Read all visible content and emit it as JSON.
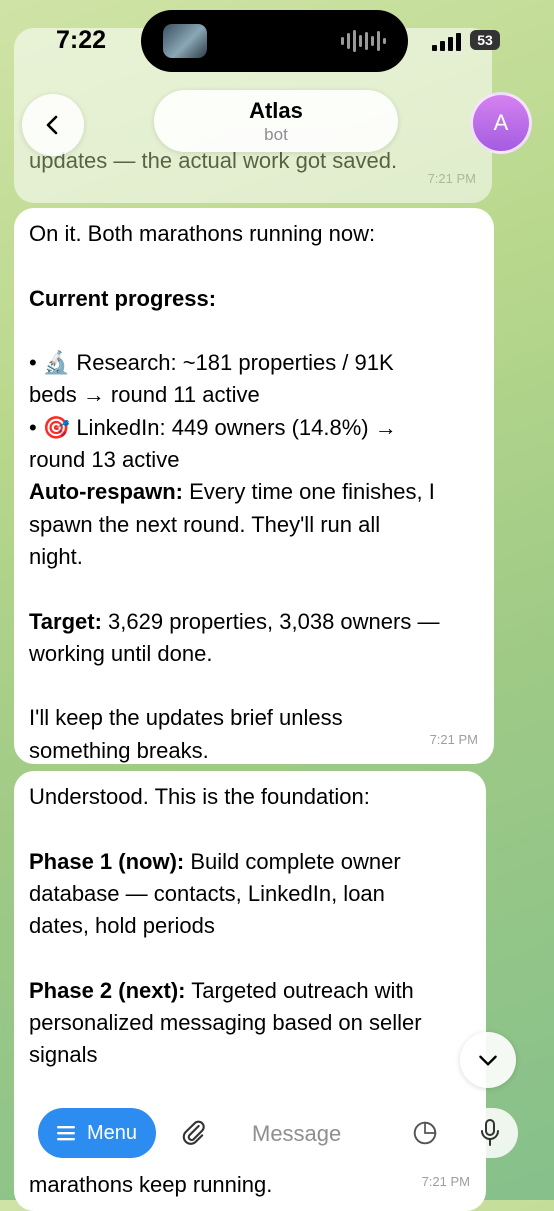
{
  "status": {
    "time": "7:22",
    "battery": "53"
  },
  "header": {
    "title": "Atlas",
    "subtitle": "bot",
    "avatar_initial": "A"
  },
  "messages": [
    {
      "partial_text": "updates — the actual work got saved.",
      "time": "7:21 PM"
    },
    {
      "intro": "On it. Both marathons running now:",
      "progress_heading": "Current progress:",
      "research_line1": "• 🔬 Research: ~181 properties / 91K",
      "research_line2": "beds → round 11 active",
      "linkedin_line1": "• 🎯 LinkedIn: 449 owners (14.8%) →",
      "linkedin_line2": "round 13 active",
      "respawn_label": "Auto-respawn:",
      "respawn_line1": " Every time one finishes, I",
      "respawn_line2": "spawn the next round. They'll run all",
      "respawn_line3": "night.",
      "target_label": "Target:",
      "target_line1": " 3,629 properties, 3,038 owners —",
      "target_line2": "working until done.",
      "closing_line1": "I'll keep the updates brief unless",
      "closing_line2": "something breaks.",
      "time": "7:21 PM"
    },
    {
      "intro": "Understood. This is the foundation:",
      "phase1_label": "Phase 1 (now):",
      "phase1_line1": " Build complete owner",
      "phase1_line2": "database — contacts, LinkedIn, loan",
      "phase1_line3": "dates, hold periods",
      "phase2_label": "Phase 2 (next):",
      "phase2_line1": " Targeted outreach with",
      "phase2_line2": "personalized messaging based on seller",
      "phase2_line3": "signals",
      "partial_line2": "marathons keep running.",
      "time": "7:21 PM"
    }
  ],
  "input_bar": {
    "menu_label": "Menu",
    "message_placeholder": "Message"
  },
  "colors": {
    "accent": "#2d8cf0",
    "bubble": "#ffffff",
    "background": "#a9d08a"
  }
}
